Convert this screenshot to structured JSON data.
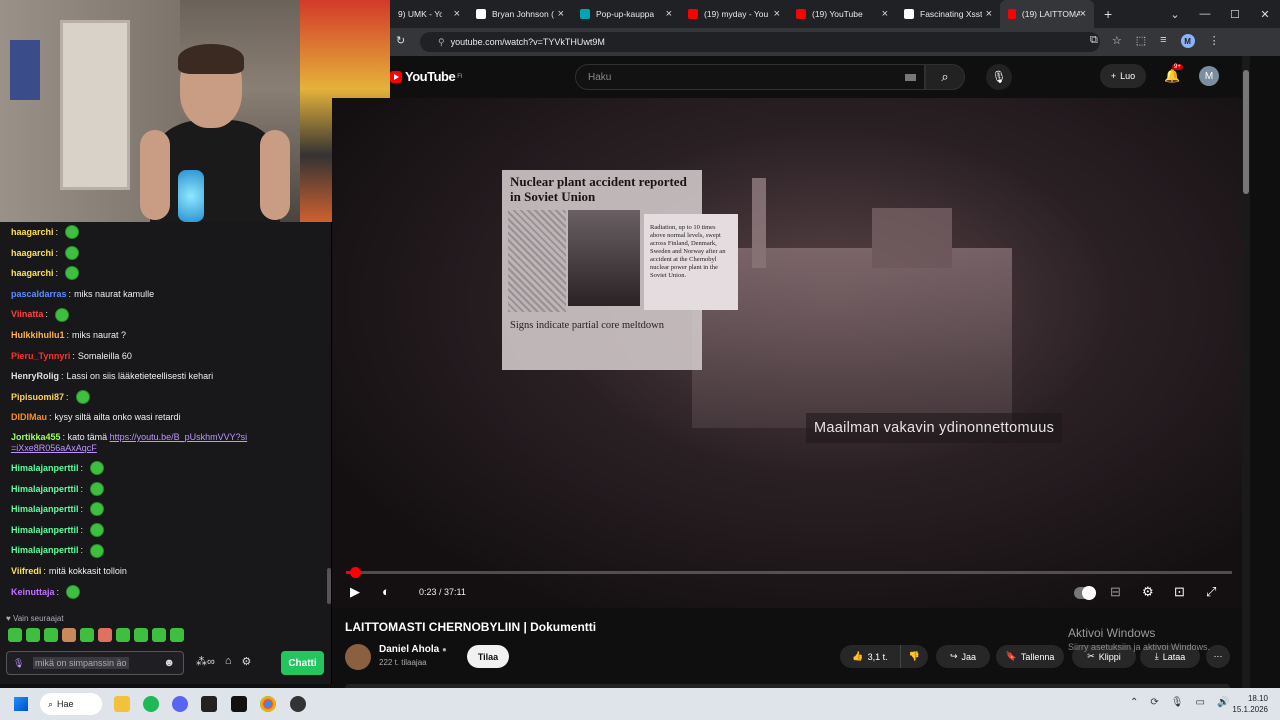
{
  "browser": {
    "tabs": [
      {
        "label": "9) UMK - YouT",
        "color": "#ff0000"
      },
      {
        "label": "Bryan Johnson (",
        "color": "#ffffff"
      },
      {
        "label": "Pop-up-kauppa",
        "color": "#00a5b5"
      },
      {
        "label": "(19) myday - You",
        "color": "#ff0000"
      },
      {
        "label": "(19) YouTube",
        "color": "#ff0000"
      },
      {
        "label": "Fascinating Xsst",
        "color": "#ffffff"
      },
      {
        "label": "(19) LAITTOMASTI",
        "color": "#ff0000"
      }
    ],
    "url": "youtube.com/watch?v=TYVkTHUwt9M"
  },
  "youtube": {
    "logo": "YouTube",
    "region": "FI",
    "search_placeholder": "Haku",
    "create_label": "Luo",
    "notifications": "9+",
    "account_initial": "M"
  },
  "video": {
    "clipping_headline": "Nuclear plant accident reported in Soviet Union",
    "clipping_note": "Radiation, up to 10 times above normal levels, swept across Finland, Denmark, Sweden and Norway after an accident at the Chernobyl nuclear power plant in the Soviet Union.",
    "clipping_sub": "Signs indicate partial core meltdown",
    "subtitle": "Maailman vakavin ydinonnettomuus",
    "time": "0:23 / 37:11",
    "progress_fraction": 0.0103,
    "title": "LAITTOMASTI CHERNOBYLIIN | Dokumentti",
    "channel": "Daniel Ahola",
    "subscribers": "222 t. tilaajaa",
    "subscribe_label": "Tilaa",
    "likes": "3,1 t.",
    "share": "Jaa",
    "save": "Tallenna",
    "clip": "Klippi",
    "download": "Lataa"
  },
  "windows_watermark": {
    "title": "Aktivoi Windows",
    "subtitle": "Siirry asetuksiin ja aktivoi Windows."
  },
  "chat": {
    "messages": [
      {
        "user": "haagarchi",
        "color": "#ffe14d",
        "text": "",
        "emote": true
      },
      {
        "user": "haagarchi",
        "color": "#ffe14d",
        "text": "",
        "emote": true
      },
      {
        "user": "haagarchi",
        "color": "#ffe14d",
        "text": "",
        "emote": true
      },
      {
        "user": "pascaldarras",
        "color": "#5c8dff",
        "text": "miks naurat kamulle",
        "emote": false
      },
      {
        "user": "Viinatta",
        "color": "#ff4040",
        "text": "",
        "emote": true
      },
      {
        "user": "Hulkkihullu1",
        "color": "#ffb347",
        "text": "miks naurat ?",
        "emote": false
      },
      {
        "user": "Pieru_Tynnyri",
        "color": "#ff3030",
        "text": "Somaleilla 60",
        "emote": false
      },
      {
        "user": "HenryRolig",
        "color": "#e0e0e0",
        "text": "Lassi on siis lääketieteellisesti kehari",
        "emote": false
      },
      {
        "user": "Pipisuomi87",
        "color": "#ffd24d",
        "text": "",
        "emote": true
      },
      {
        "user": "DIDIMau",
        "color": "#ff8c1a",
        "text": "kysy siltä ailta onko wasi retardi",
        "emote": false
      },
      {
        "user": "Himalajanperttil",
        "color": "#5cff9d",
        "text": "",
        "emote": true
      },
      {
        "user": "Himalajanperttil",
        "color": "#5cff9d",
        "text": "",
        "emote": true
      },
      {
        "user": "Himalajanperttil",
        "color": "#5cff9d",
        "text": "",
        "emote": true
      },
      {
        "user": "Himalajanperttil",
        "color": "#5cff9d",
        "text": "",
        "emote": true
      },
      {
        "user": "Himalajanperttil",
        "color": "#5cff9d",
        "text": "",
        "emote": true
      },
      {
        "user": "Viifredi",
        "color": "#ffe14d",
        "text": "mitä kokkasit tolloin",
        "emote": false
      },
      {
        "user": "Keinuttaja",
        "color": "#c070ff",
        "text": "",
        "emote": true
      }
    ],
    "link_message": {
      "user": "Jortikka455",
      "color": "#9dff5c",
      "text": "kato tämä",
      "link": "https://youtu.be/B_pUskhmVVY?si=iXxe8R056aAxAqcF"
    },
    "follow_note": "Vain seuraajat",
    "input_placeholder": "mikä on simpanssin äo",
    "chat_button": "Chatti"
  },
  "taskbar": {
    "search_label": "Hae",
    "time": "18.10",
    "date": "15.1.2026"
  }
}
